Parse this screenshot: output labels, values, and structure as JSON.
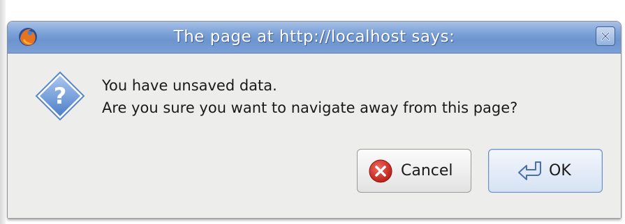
{
  "dialog": {
    "title": "The page at http://localhost says:",
    "app_icon": "firefox-icon",
    "close_icon": "close-icon",
    "message_icon": "question-icon",
    "message_lines": [
      "You have unsaved data.",
      "Are you sure you want to navigate away from this page?"
    ],
    "buttons": {
      "cancel": {
        "label": "Cancel",
        "icon": "cancel-icon"
      },
      "ok": {
        "label": "OK",
        "icon": "ok-return-icon"
      }
    }
  },
  "colors": {
    "titlebar": "#7ea3d8",
    "dialog_bg": "#ededeb",
    "title_text": "#ffffff",
    "cancel_icon": "#d8281e",
    "question_icon": "#5f8fd0"
  }
}
